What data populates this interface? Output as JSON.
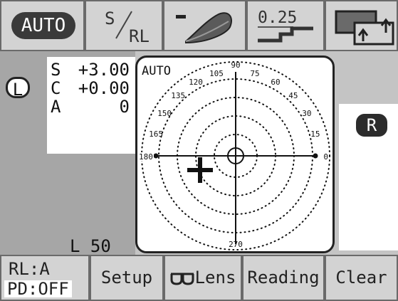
{
  "toolbar": {
    "auto_label": "AUTO",
    "srl_top": "S",
    "srl_bottom": "RL",
    "step_label": "0.25",
    "lens_icon": "lens-profile-icon",
    "step_icon": "step-increment-icon",
    "window_icon": "window-swap-icon"
  },
  "left_lens": {
    "badge": "L",
    "readings": [
      {
        "label": "S",
        "value": "+3.00"
      },
      {
        "label": "C",
        "value": "+0.00"
      },
      {
        "label": "A",
        "value": "0"
      }
    ],
    "pd": "L 50"
  },
  "target": {
    "mode": "AUTO",
    "angles": [
      "90",
      "75",
      "60",
      "45",
      "30",
      "15",
      "0",
      "105",
      "120",
      "135",
      "150",
      "165",
      "180",
      "270"
    ]
  },
  "right_lens": {
    "badge": "R"
  },
  "bottom_bar": {
    "rl_mode": "RL:A",
    "pd_mode": "PD:OFF",
    "setup": "Setup",
    "lens": "Lens",
    "reading": "Reading",
    "clear": "Clear"
  },
  "colors": {
    "button_bg": "#d3d3d3",
    "panel_bg": "#a6a6a6",
    "badge_dark": "#2c2c2c"
  }
}
